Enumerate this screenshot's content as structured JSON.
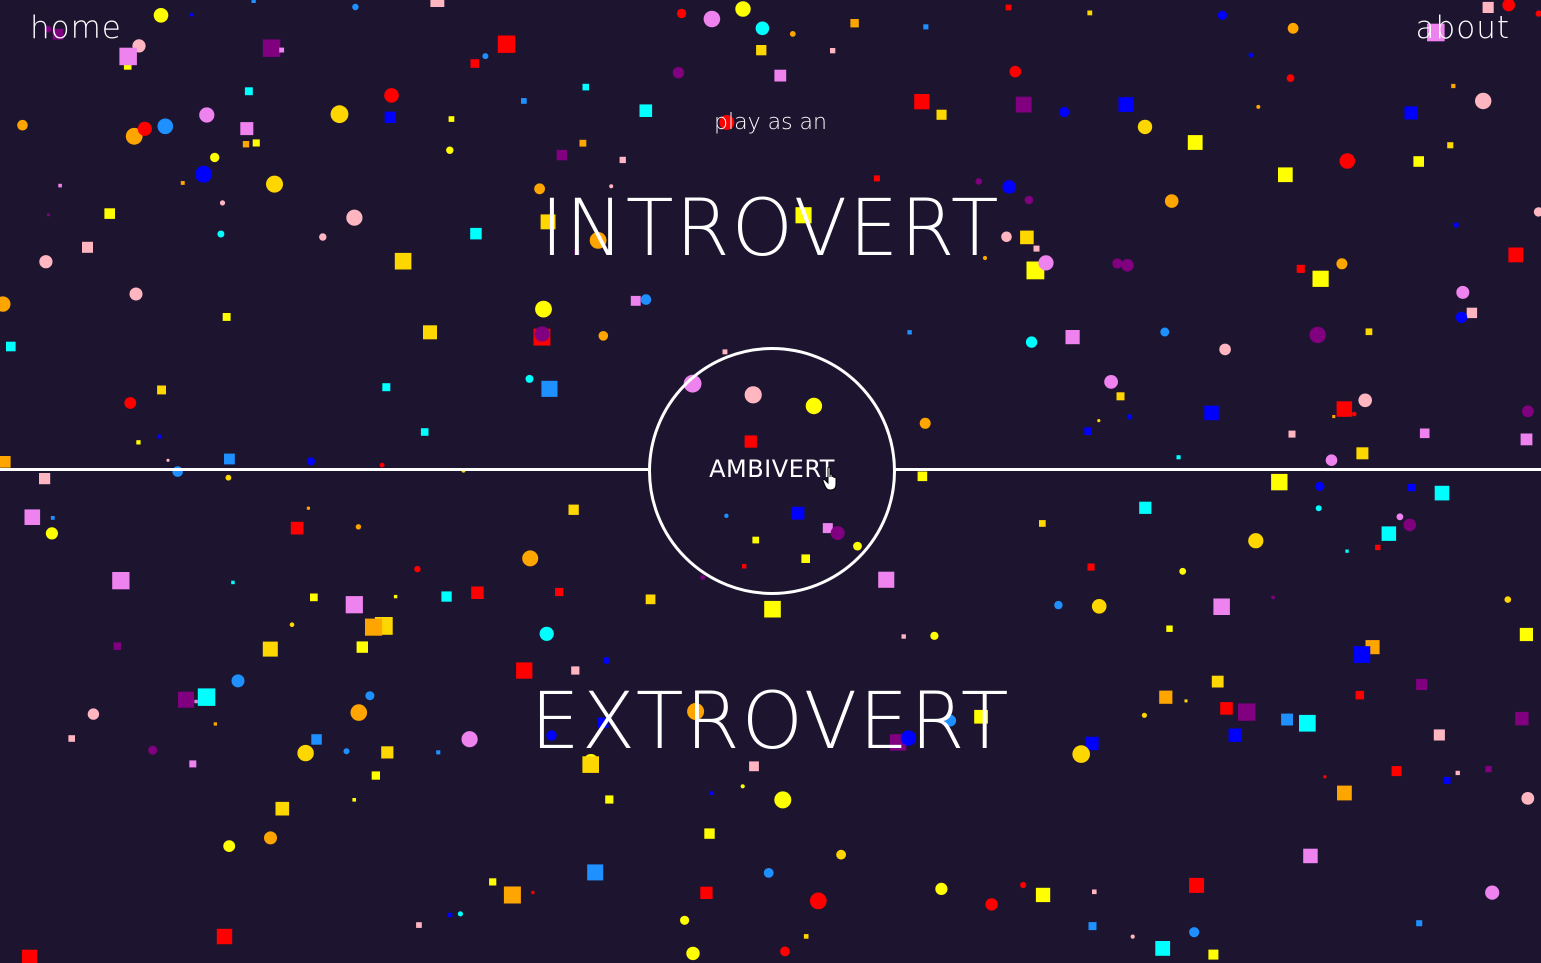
{
  "nav": {
    "home_label": "home",
    "about_label": "about"
  },
  "hero": {
    "subtitle": "play as an",
    "introvert_label": "INTROVERT",
    "ambivert_label": "AMBIVERT",
    "extrovert_label": "EXTROVERT"
  },
  "theme": {
    "background": "#1d1530",
    "foreground": "#ffffff",
    "confetti_colors": [
      "#ff0000",
      "#ffff00",
      "#ffd700",
      "#ffa500",
      "#ffb6c1",
      "#00ffff",
      "#1e90ff",
      "#0000ff",
      "#ee82ee",
      "#800080"
    ]
  },
  "icons": {
    "cursor": "hand-pointer-icon"
  }
}
